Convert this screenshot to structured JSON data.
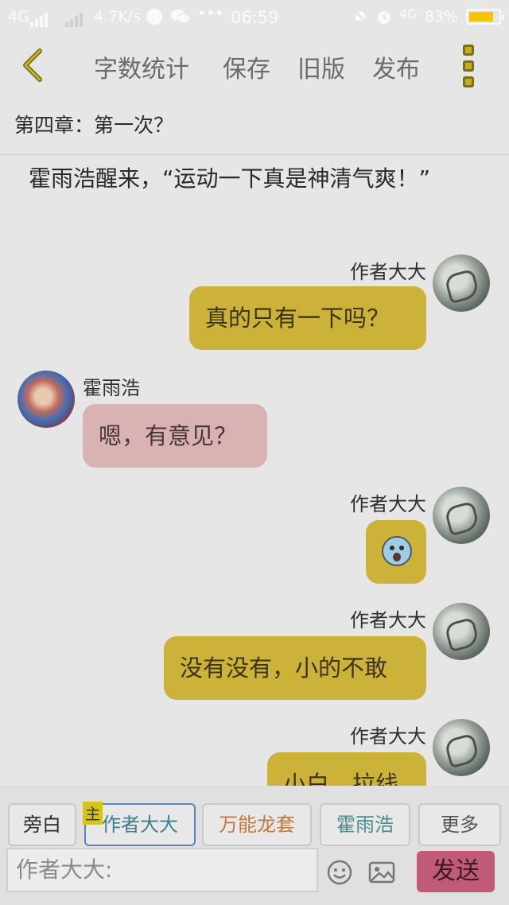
{
  "status_bar": {
    "network_left": "4G",
    "speed": "4.7K/s",
    "dots": "•••",
    "time": "06:59",
    "network_right": "4G",
    "battery": "83%",
    "battery_level": 0.83
  },
  "toolbar": {
    "back_icon": "chevron-left-icon",
    "word_count": "字数统计",
    "save": "保存",
    "old_version": "旧版",
    "publish": "发布",
    "more_icon": "more-vertical-icon"
  },
  "chapter_title": "第四章：第一次？",
  "narration": "霍雨浩醒来，“运动一下真是神清气爽！”",
  "messages": [
    {
      "speaker": "作者大大",
      "side": "right",
      "text": "真的只有一下吗？"
    },
    {
      "speaker": "霍雨浩",
      "side": "left",
      "text": "嗯，有意见？"
    },
    {
      "speaker": "作者大大",
      "side": "right",
      "text": "",
      "emoji": "scream-emoji"
    },
    {
      "speaker": "作者大大",
      "side": "right",
      "text": "没有没有，小的不敢"
    },
    {
      "speaker": "作者大大",
      "side": "right",
      "text": "小白，拉线"
    }
  ],
  "roles": {
    "narrator": "旁白",
    "author": "作者大大",
    "author_badge": "主",
    "universal": "万能龙套",
    "hero": "霍雨浩",
    "more": "更多"
  },
  "composer": {
    "placeholder": "作者大大:",
    "emoji_icon": "smiley-icon",
    "image_icon": "image-icon",
    "send": "发送"
  },
  "colors": {
    "author_bubble": "#cdb23a",
    "hero_bubble": "#d9b3b3",
    "send_button": "#c05a78",
    "accent_yellow": "#d6c21e"
  }
}
